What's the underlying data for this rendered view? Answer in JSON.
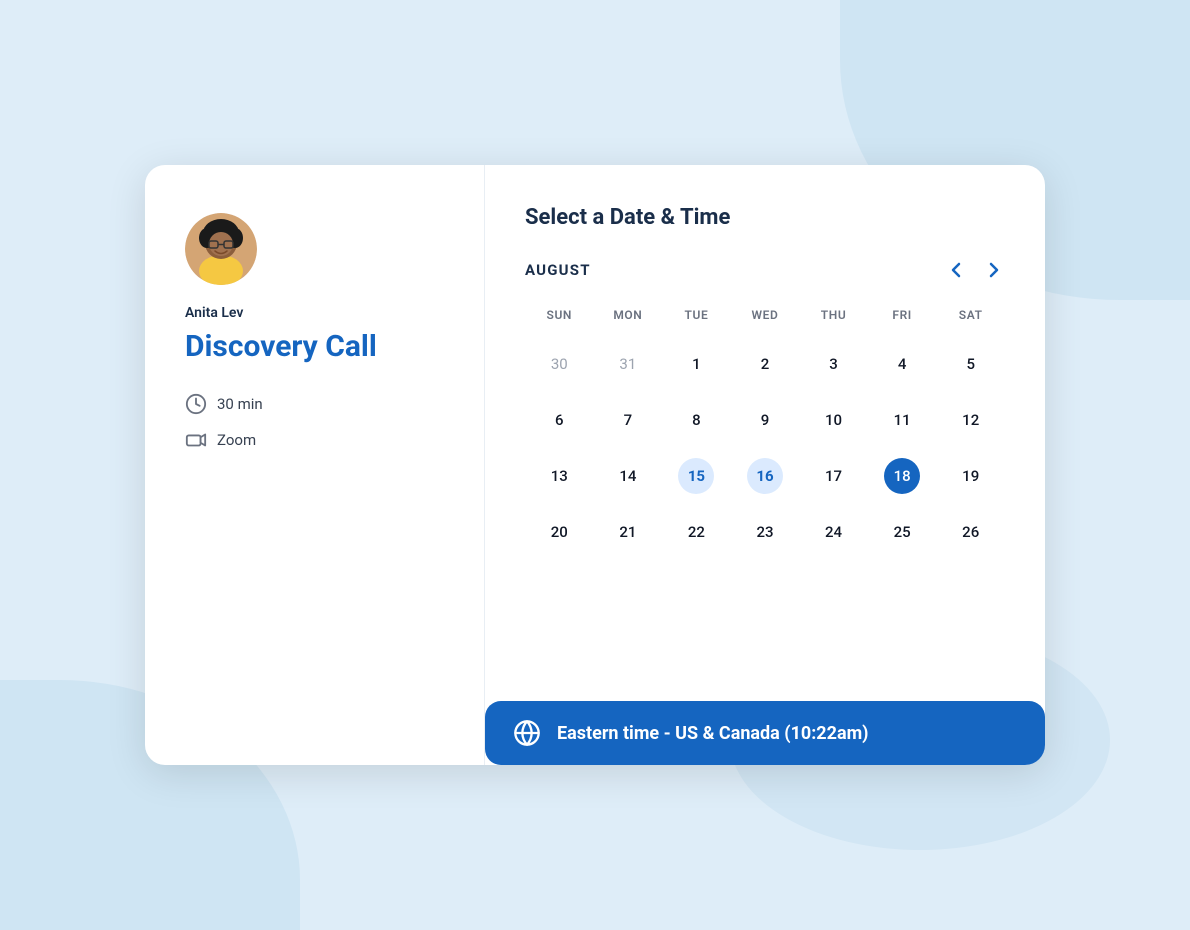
{
  "background": {
    "color": "#deedf8"
  },
  "left_panel": {
    "host_name": "Anita Lev",
    "event_title": "Discovery Call",
    "duration": "30 min",
    "meeting_type": "Zoom"
  },
  "right_panel": {
    "section_title": "Select a Date & Time",
    "calendar": {
      "month": "AUGUST",
      "day_headers": [
        "SUN",
        "MON",
        "TUE",
        "WED",
        "THU",
        "FRI",
        "SAT"
      ],
      "weeks": [
        [
          {
            "day": "30",
            "state": "inactive"
          },
          {
            "day": "31",
            "state": "inactive"
          },
          {
            "day": "1",
            "state": "active"
          },
          {
            "day": "2",
            "state": "active"
          },
          {
            "day": "3",
            "state": "active"
          },
          {
            "day": "4",
            "state": "active"
          },
          {
            "day": "5",
            "state": "active"
          }
        ],
        [
          {
            "day": "6",
            "state": "active"
          },
          {
            "day": "7",
            "state": "active"
          },
          {
            "day": "8",
            "state": "active"
          },
          {
            "day": "9",
            "state": "active"
          },
          {
            "day": "10",
            "state": "active"
          },
          {
            "day": "11",
            "state": "active"
          },
          {
            "day": "12",
            "state": "active"
          }
        ],
        [
          {
            "day": "13",
            "state": "active"
          },
          {
            "day": "14",
            "state": "active"
          },
          {
            "day": "15",
            "state": "highlighted"
          },
          {
            "day": "16",
            "state": "highlighted"
          },
          {
            "day": "17",
            "state": "active"
          },
          {
            "day": "18",
            "state": "selected"
          },
          {
            "day": "19",
            "state": "active"
          }
        ],
        [
          {
            "day": "20",
            "state": "active"
          },
          {
            "day": "21",
            "state": "active"
          },
          {
            "day": "22",
            "state": "active"
          },
          {
            "day": "23",
            "state": "active"
          },
          {
            "day": "24",
            "state": "active"
          },
          {
            "day": "25",
            "state": "active"
          },
          {
            "day": "26",
            "state": "active"
          }
        ]
      ]
    },
    "timezone": {
      "label": "Eastern time - US & Canada (10:22am)"
    }
  },
  "nav": {
    "prev_label": "‹",
    "next_label": "›"
  }
}
